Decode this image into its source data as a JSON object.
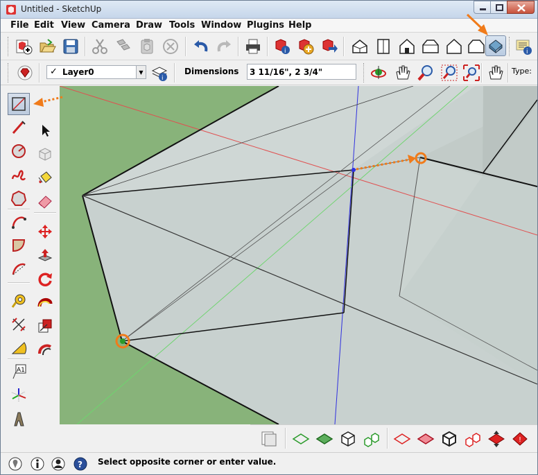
{
  "window": {
    "title": "Untitled - SketchUp",
    "app_icon": "sketchup-logo-icon"
  },
  "menu": [
    "File",
    "Edit",
    "View",
    "Camera",
    "Draw",
    "Tools",
    "Window",
    "Plugins",
    "Help"
  ],
  "layer": {
    "current": "Layer0"
  },
  "measurements": {
    "label": "Dimensions",
    "value": "3 11/16\", 2 3/4\""
  },
  "type_label": "Type:",
  "toolbar_icons": [
    "component-maker-icon",
    "open-icon",
    "save-icon",
    "cut-icon",
    "copy-icon",
    "paste-icon",
    "erase-icon",
    "undo-icon",
    "redo-icon",
    "print-icon",
    "model-info-icon",
    "get-models-icon",
    "share-model-icon",
    "iso-view-icon",
    "top-view-icon",
    "front-view-icon",
    "right-view-icon",
    "back-view-icon",
    "left-view-icon",
    "display-mode-icon",
    "tip-icon"
  ],
  "palette_icons": [
    "rectangle-icon",
    "line-icon",
    "select-icon",
    "circle-icon",
    "make-component-icon",
    "freehand-icon",
    "paint-bucket-icon",
    "polygon-icon",
    "eraser-icon",
    "arc-icon",
    "move-icon",
    "pie-icon",
    "push-pull-icon",
    "three-point-arc-icon",
    "rotate-icon",
    "tape-measure-icon",
    "follow-me-icon",
    "dimension-icon",
    "scale-icon",
    "protractor-icon",
    "offset-icon",
    "text-icon",
    "axes-icon",
    "3d-text-icon"
  ],
  "status": {
    "message": "Select opposite corner or enter value."
  },
  "colors": {
    "ground": "#88b37a",
    "face": "#c7d0cd",
    "annotation": "#f07b1a",
    "red_axis": "#e05050",
    "green_axis": "#6fd46f",
    "blue_axis": "#3030e0"
  }
}
